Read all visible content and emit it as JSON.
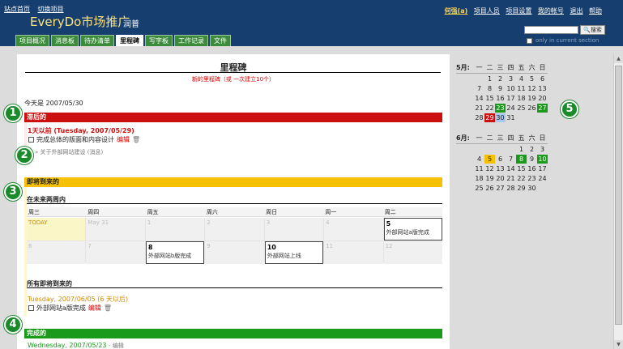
{
  "header": {
    "top_links": [
      "站点首页",
      "切换项目"
    ],
    "project_name": "EveryDo市场推广",
    "project_owner": "润普",
    "user_links": [
      "何强(a)",
      "项目人员",
      "项目设置",
      "我的帐号",
      "退出",
      "帮助"
    ],
    "search_button": "搜索",
    "only_current": "only in current section"
  },
  "tabs": [
    "项目概况",
    "消息板",
    "待办清单",
    "里程碑",
    "写字板",
    "工作记录",
    "文件"
  ],
  "active_tab": "里程碑",
  "main": {
    "title": "里程碑",
    "new_link": "新的里程碑（或 一次建立10个）",
    "today": "今天是 2007/05/30",
    "late": {
      "heading": "滞后的",
      "date": "1天以前 (Tuesday, 2007/05/29)",
      "task": "完成总体的版面和内容设计",
      "edit": "编辑",
      "message": "关于外部网站建设 (消息)"
    },
    "upcoming": {
      "heading": "即将到来的",
      "two_weeks": "在未来两周内",
      "weekdays": [
        "周三",
        "周四",
        "周五",
        "周六",
        "周日",
        "周一",
        "周二"
      ],
      "cells": [
        {
          "day": "TODAY",
          "kind": "today",
          "event": ""
        },
        {
          "day": "May 31",
          "kind": "normal",
          "event": ""
        },
        {
          "day": "1",
          "kind": "normal",
          "event": ""
        },
        {
          "day": "2",
          "kind": "normal",
          "event": ""
        },
        {
          "day": "3",
          "kind": "normal",
          "event": ""
        },
        {
          "day": "4",
          "kind": "normal",
          "event": ""
        },
        {
          "day": "5",
          "kind": "event",
          "event": "外部网站a版完成"
        },
        {
          "day": "6",
          "kind": "normal",
          "event": ""
        },
        {
          "day": "7",
          "kind": "normal",
          "event": ""
        },
        {
          "day": "8",
          "kind": "event",
          "event": "外部网站b版完成"
        },
        {
          "day": "9",
          "kind": "normal",
          "event": ""
        },
        {
          "day": "10",
          "kind": "event",
          "event": "外部网站上线"
        },
        {
          "day": "11",
          "kind": "normal",
          "event": ""
        },
        {
          "day": "12",
          "kind": "normal",
          "event": ""
        }
      ],
      "all_heading": "所有即将到来的",
      "date": "Tuesday, 2007/06/05 (6 天以后)",
      "task": "外部网站a版完成",
      "edit": "编辑"
    },
    "done": {
      "heading": "完成的",
      "date": "Wednesday, 2007/05/23",
      "edit": "- 编辑"
    }
  },
  "mini_calendars": [
    {
      "month": "5月:",
      "weekdays": [
        "一",
        "二",
        "三",
        "四",
        "五",
        "六",
        "日"
      ],
      "rows": [
        [
          {
            "d": ""
          },
          {
            "d": "1"
          },
          {
            "d": "2"
          },
          {
            "d": "3"
          },
          {
            "d": "4"
          },
          {
            "d": "5"
          },
          {
            "d": "6"
          }
        ],
        [
          {
            "d": "7"
          },
          {
            "d": "8"
          },
          {
            "d": "9"
          },
          {
            "d": "10"
          },
          {
            "d": "11"
          },
          {
            "d": "12"
          },
          {
            "d": "13"
          }
        ],
        [
          {
            "d": "14"
          },
          {
            "d": "15"
          },
          {
            "d": "16"
          },
          {
            "d": "17"
          },
          {
            "d": "18"
          },
          {
            "d": "19"
          },
          {
            "d": "20"
          }
        ],
        [
          {
            "d": "21"
          },
          {
            "d": "22"
          },
          {
            "d": "23",
            "c": "grn"
          },
          {
            "d": "24"
          },
          {
            "d": "25"
          },
          {
            "d": "26"
          },
          {
            "d": "27",
            "c": "grn"
          }
        ],
        [
          {
            "d": "28"
          },
          {
            "d": "29",
            "c": "red"
          },
          {
            "d": "30",
            "c": "blu"
          },
          {
            "d": "31"
          },
          {
            "d": ""
          },
          {
            "d": ""
          },
          {
            "d": ""
          }
        ]
      ]
    },
    {
      "month": "6月:",
      "weekdays": [
        "一",
        "二",
        "三",
        "四",
        "五",
        "六",
        "日"
      ],
      "rows": [
        [
          {
            "d": ""
          },
          {
            "d": ""
          },
          {
            "d": ""
          },
          {
            "d": ""
          },
          {
            "d": "1"
          },
          {
            "d": "2"
          },
          {
            "d": "3"
          }
        ],
        [
          {
            "d": "4"
          },
          {
            "d": "5",
            "c": "yel"
          },
          {
            "d": "6"
          },
          {
            "d": "7"
          },
          {
            "d": "8",
            "c": "grn"
          },
          {
            "d": "9"
          },
          {
            "d": "10",
            "c": "grn"
          }
        ],
        [
          {
            "d": "11"
          },
          {
            "d": "12"
          },
          {
            "d": "13"
          },
          {
            "d": "14"
          },
          {
            "d": "15"
          },
          {
            "d": "16"
          },
          {
            "d": "17"
          }
        ],
        [
          {
            "d": "18"
          },
          {
            "d": "19"
          },
          {
            "d": "20"
          },
          {
            "d": "21"
          },
          {
            "d": "22"
          },
          {
            "d": "23"
          },
          {
            "d": "24"
          }
        ],
        [
          {
            "d": "25"
          },
          {
            "d": "26"
          },
          {
            "d": "27"
          },
          {
            "d": "28"
          },
          {
            "d": "29"
          },
          {
            "d": "30"
          },
          {
            "d": ""
          }
        ]
      ]
    }
  ],
  "callouts": [
    "1",
    "2",
    "3",
    "4",
    "5"
  ],
  "colors": {
    "header": "#163e6e",
    "late": "#cc1010",
    "upcoming": "#f5c100",
    "done": "#1a9a1a",
    "callout": "#1a8a2a"
  }
}
